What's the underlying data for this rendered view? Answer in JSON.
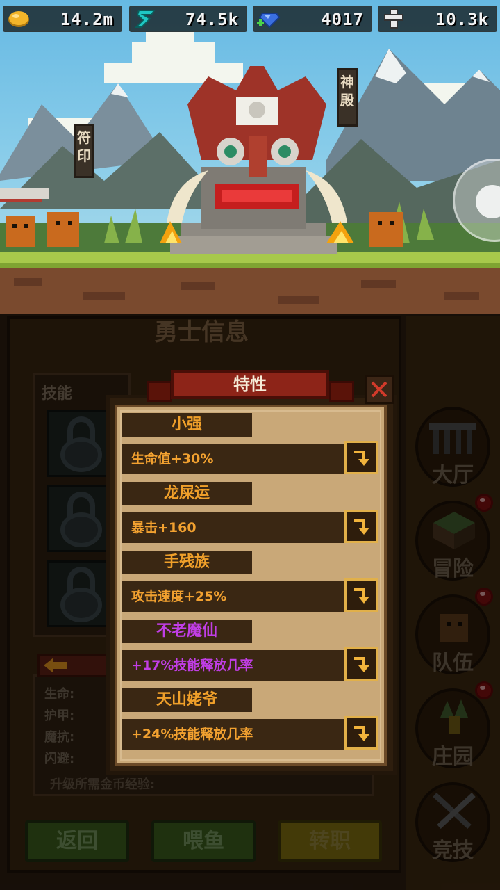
{
  "resources": [
    {
      "icon": "gold-coin-icon",
      "value": "14.2m"
    },
    {
      "icon": "teal-rune-icon",
      "value": "74.5k"
    },
    {
      "icon": "gem-icon",
      "value": "4017"
    },
    {
      "icon": "cross-icon",
      "value": "10.3k"
    }
  ],
  "scene": {
    "sign_left": "符印",
    "sign_right": "神殿"
  },
  "hero_panel": {
    "title": "勇士信息",
    "skills_label": "技能",
    "stats": [
      "生命:",
      "护甲:",
      "魔抗:",
      "闪避:"
    ],
    "exp_label": "升级所需金币经验:"
  },
  "bottom_buttons": {
    "back": "返回",
    "feed": "喂鱼",
    "transfer": "转职"
  },
  "sidebar": {
    "hall": "大厅",
    "adventure": "冒险",
    "team": "队伍",
    "manor": "庄园",
    "arena": "竞技"
  },
  "modal": {
    "title": "特性",
    "traits": [
      {
        "name": "小强",
        "effect": "生命值+30%",
        "rarity": "normal"
      },
      {
        "name": "龙屎运",
        "effect": "暴击+160",
        "rarity": "normal"
      },
      {
        "name": "手残族",
        "effect": "攻击速度+25%",
        "rarity": "normal"
      },
      {
        "name": "不老魔仙",
        "effect": "+17%技能释放几率",
        "rarity": "epic"
      },
      {
        "name": "天山姥爷",
        "effect": "+24%技能释放几率",
        "rarity": "normal"
      }
    ]
  },
  "colors": {
    "trait_normal": "#f2a130",
    "trait_epic": "#c13ee6",
    "title_bar": "#8d2418",
    "add_border": "#e1b04a"
  }
}
